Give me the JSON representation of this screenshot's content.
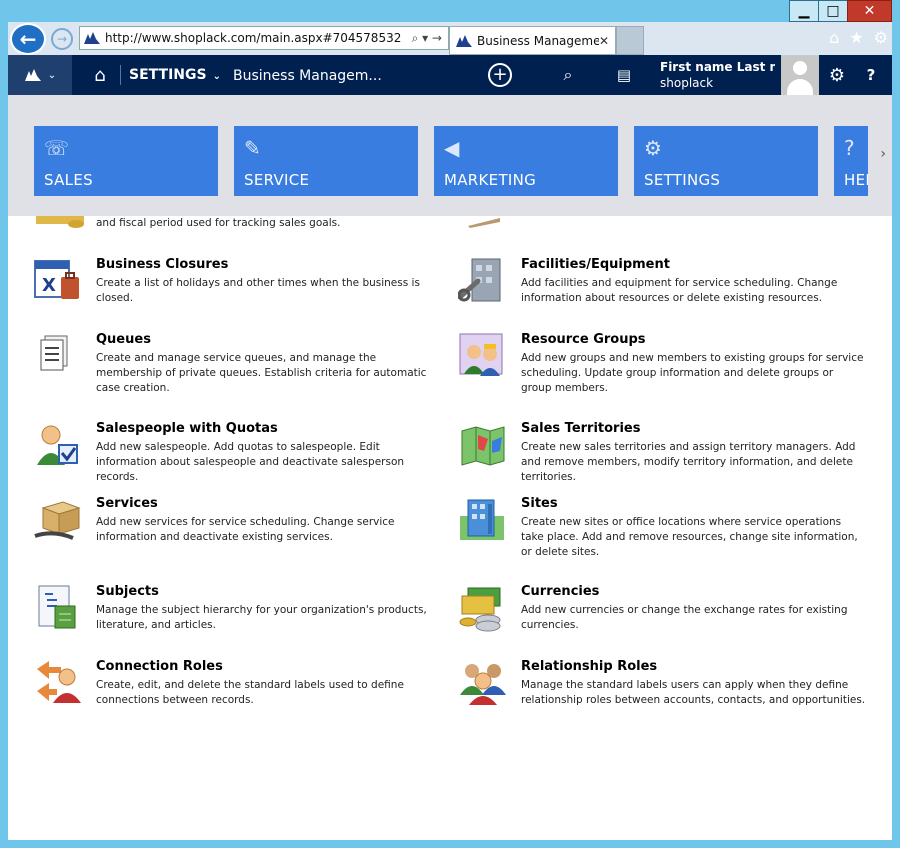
{
  "window": {
    "minimize_label": "▁",
    "maximize_label": "□",
    "close_label": "✕"
  },
  "browser": {
    "url": "http://www.shoplack.com/main.aspx#704578532",
    "tab_title": "Business Manageme...",
    "tab_close": "✕",
    "addr_controls": "⌕ ▾ →"
  },
  "crm": {
    "settings_label": "SETTINGS",
    "breadcrumb": "Business Managem...",
    "user_name": "First name Last n...",
    "org_name": "shoplack",
    "help_label": "?"
  },
  "tiles": [
    {
      "label": "SALES",
      "icon": "sales-icon"
    },
    {
      "label": "SERVICE",
      "icon": "service-icon"
    },
    {
      "label": "MARKETING",
      "icon": "megaphone-icon"
    },
    {
      "label": "SETTINGS",
      "icon": "gear-icon"
    },
    {
      "label": "HEL",
      "icon": "help-icon"
    }
  ],
  "partial_row_desc": "and fiscal period used for tracking sales goals.",
  "items": [
    {
      "title": "Business Closures",
      "desc": "Create a list of holidays and other times when the business is closed."
    },
    {
      "title": "Facilities/Equipment",
      "desc": "Add facilities and equipment for service scheduling. Change information about resources or delete existing resources."
    },
    {
      "title": "Queues",
      "desc": "Create and manage service queues, and manage the membership of private queues. Establish criteria for automatic case creation."
    },
    {
      "title": "Resource Groups",
      "desc": "Add new groups and new members to existing groups for service scheduling. Update group information and delete groups or group members."
    },
    {
      "title": "Salespeople with Quotas",
      "desc": "Add new salespeople. Add quotas to salespeople. Edit information about salespeople and deactivate salesperson records."
    },
    {
      "title": "Sales Territories",
      "desc": "Create new sales territories and assign territory managers. Add and remove members, modify territory information, and delete territories."
    },
    {
      "title": "Services",
      "desc": "Add new services for service scheduling. Change service information and deactivate existing services."
    },
    {
      "title": "Sites",
      "desc": "Create new sites or office locations where service operations take place. Add and remove resources, change site information, or delete sites."
    },
    {
      "title": "Subjects",
      "desc": "Manage the subject hierarchy for your organization's products, literature, and articles."
    },
    {
      "title": "Currencies",
      "desc": "Add new currencies or change the exchange rates for existing currencies."
    },
    {
      "title": "Connection Roles",
      "desc": "Create, edit, and delete the standard labels used to define connections between records."
    },
    {
      "title": "Relationship Roles",
      "desc": "Manage the standard labels users can apply when they define relationship roles between accounts, contacts, and opportunities."
    }
  ]
}
